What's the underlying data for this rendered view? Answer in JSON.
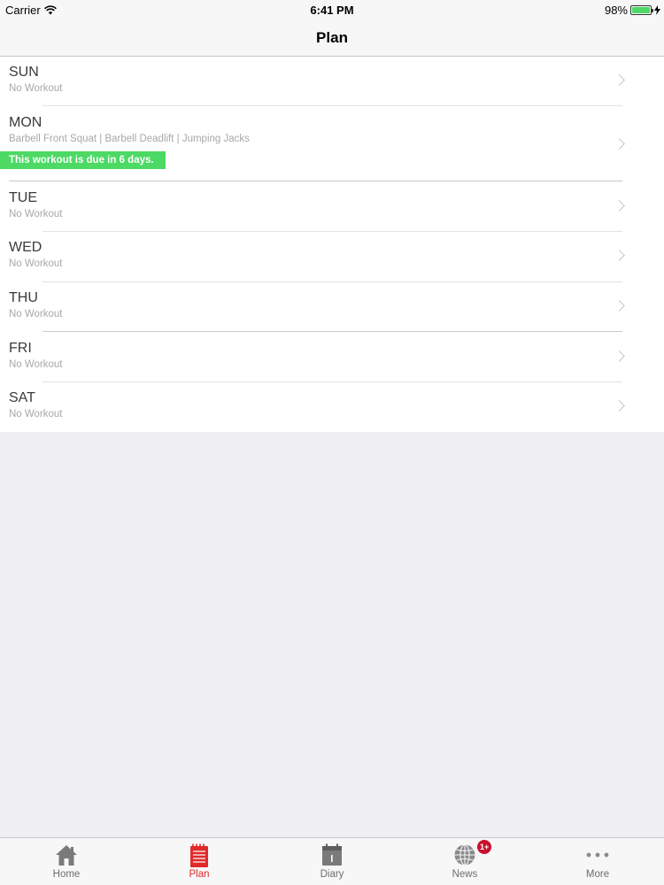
{
  "status_bar": {
    "carrier": "Carrier",
    "time": "6:41 PM",
    "battery": "98%",
    "battery_level": 0.98
  },
  "nav": {
    "title": "Plan"
  },
  "days": [
    {
      "name": "SUN",
      "detail": "No Workout"
    },
    {
      "name": "MON",
      "detail": "Barbell Front Squat | Barbell Deadlift | Jumping Jacks",
      "due": "This workout is due in 6 days."
    },
    {
      "name": "TUE",
      "detail": "No Workout"
    },
    {
      "name": "WED",
      "detail": "No Workout"
    },
    {
      "name": "THU",
      "detail": "No Workout"
    },
    {
      "name": "FRI",
      "detail": "No Workout"
    },
    {
      "name": "SAT",
      "detail": "No Workout"
    }
  ],
  "tabs": [
    {
      "label": "Home",
      "icon": "home-icon"
    },
    {
      "label": "Plan",
      "icon": "notepad-icon",
      "active": true
    },
    {
      "label": "Diary",
      "icon": "calendar-icon"
    },
    {
      "label": "News",
      "icon": "globe-icon",
      "badge": "1+"
    },
    {
      "label": "More",
      "icon": "more-icon"
    }
  ],
  "colors": {
    "accent": "#e02b2b",
    "due_green": "#4cd964",
    "badge_red": "#c8102e"
  }
}
